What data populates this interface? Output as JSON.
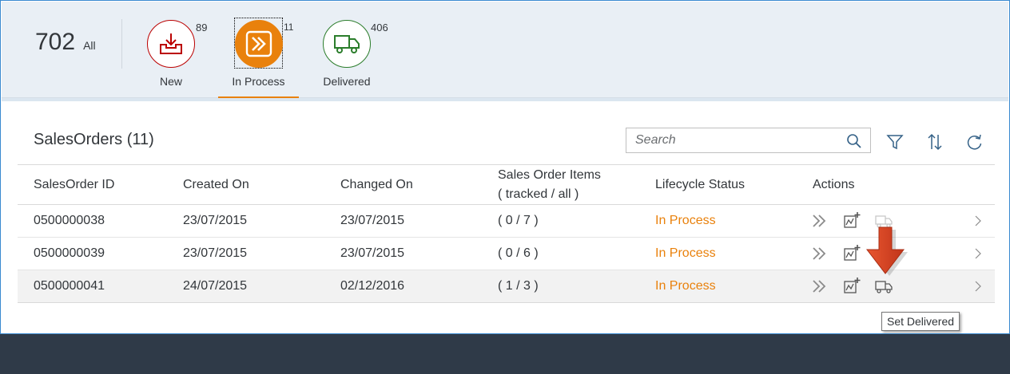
{
  "header": {
    "all_count": "702",
    "all_label": "All",
    "tabs": [
      {
        "label": "New",
        "count": "89",
        "icon": "download-inbox-icon"
      },
      {
        "label": "In Process",
        "count": "11",
        "icon": "fast-forward-icon"
      },
      {
        "label": "Delivered",
        "count": "406",
        "icon": "delivery-truck-icon"
      }
    ]
  },
  "table": {
    "title": "SalesOrders (11)",
    "search_placeholder": "Search",
    "columns": {
      "id": "SalesOrder ID",
      "created": "Created On",
      "changed": "Changed On",
      "items_line1": "Sales Order Items",
      "items_line2": "( tracked / all )",
      "status": "Lifecycle Status",
      "actions": "Actions"
    },
    "rows": [
      {
        "id": "0500000038",
        "created": "23/07/2015",
        "changed": "23/07/2015",
        "items": "( 0 / 7 )",
        "status": "In Process"
      },
      {
        "id": "0500000039",
        "created": "23/07/2015",
        "changed": "23/07/2015",
        "items": "( 0 / 6 )",
        "status": "In Process"
      },
      {
        "id": "0500000041",
        "created": "24/07/2015",
        "changed": "02/12/2016",
        "items": "( 1 / 3 )",
        "status": "In Process"
      }
    ]
  },
  "tooltip": "Set Delivered",
  "colors": {
    "accent_orange": "#e9810c",
    "negative_red": "#bb0000",
    "positive_green": "#2b7d2b",
    "header_bg": "#e9eff5",
    "footer_bg": "#2f3a48"
  }
}
